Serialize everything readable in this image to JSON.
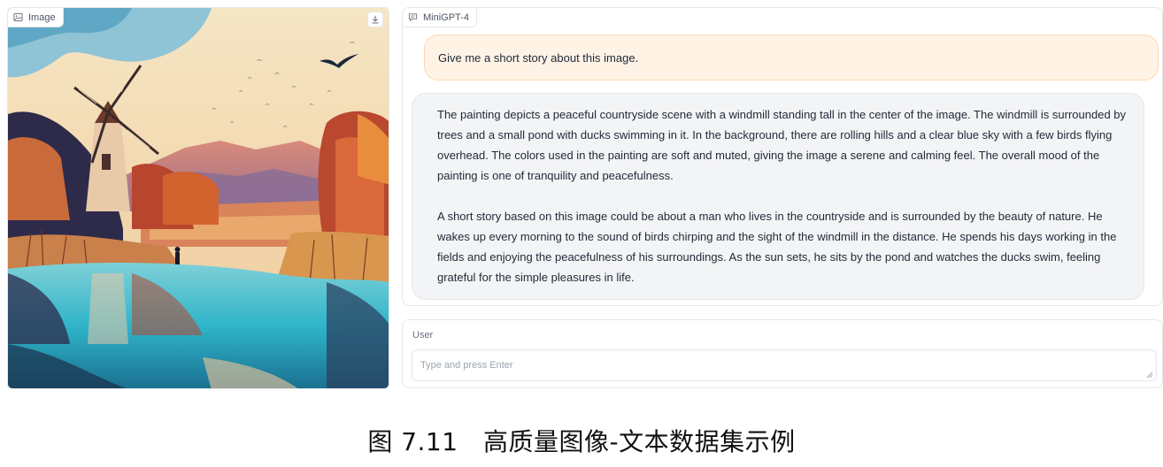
{
  "image_panel": {
    "label": "Image",
    "label_icon": "image-icon",
    "download_icon": "download-icon"
  },
  "chat": {
    "label": "MiniGPT-4",
    "label_icon": "chat-bubble-icon",
    "messages": [
      {
        "role": "user",
        "text": "Give me a short story about this image."
      },
      {
        "role": "bot",
        "paragraphs": [
          "The painting depicts a peaceful countryside scene with a windmill standing tall in the center of the image. The windmill is surrounded by trees and a small pond with ducks swimming in it. In the background, there are rolling hills and a clear blue sky with a few birds flying overhead. The colors used in the painting are soft and muted, giving the image a serene and calming feel. The overall mood of the painting is one of tranquility and peacefulness.",
          "A short story based on this image could be about a man who lives in the countryside and is surrounded by the beauty of nature. He wakes up every morning to the sound of birds chirping and the sight of the windmill in the distance. He spends his days working in the fields and enjoying the peacefulness of his surroundings. As the sun sets, he sits by the pond and watches the ducks swim, feeling grateful for the simple pleasures in life."
        ]
      }
    ]
  },
  "input": {
    "label": "User",
    "placeholder": "Type and press Enter",
    "value": ""
  },
  "caption": "图 7.11　高质量图像-文本数据集示例",
  "colors": {
    "user_bubble": "#fff3e6",
    "user_bubble_border": "#fdd9b5",
    "bot_bubble": "#f3f4f6"
  }
}
